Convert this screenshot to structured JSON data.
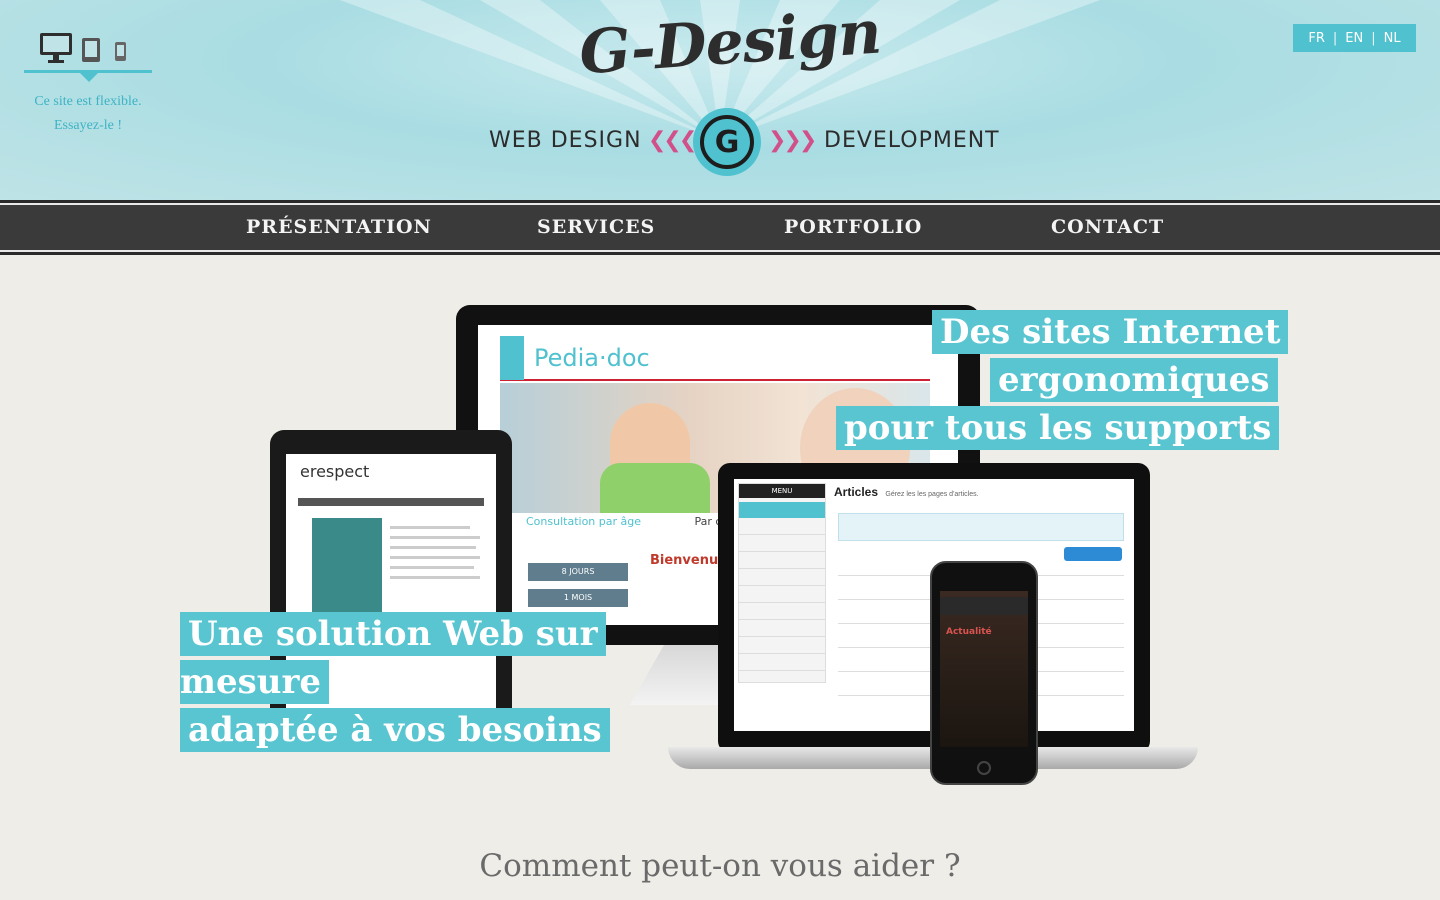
{
  "header": {
    "flex_note_line1": "Ce site est flexible.",
    "flex_note_line2": "Essayez-le !",
    "device_icons": [
      "desktop-icon",
      "tablet-icon",
      "phone-icon"
    ],
    "languages": [
      "FR",
      "EN",
      "NL"
    ],
    "logo": "G-Design",
    "tagline_left": "WEB DESIGN",
    "tagline_right": "DEVELOPMENT",
    "emblem_letter": "G",
    "accent_color": "#4fc1cf",
    "chevron_color": "#d2508a"
  },
  "nav": {
    "items": [
      "PRÉSENTATION",
      "SERVICES",
      "PORTFOLIO",
      "CONTACT"
    ]
  },
  "hero": {
    "headline_right": [
      "Des sites Internet",
      "ergonomiques",
      "pour tous les supports"
    ],
    "headline_left": [
      "Une solution Web sur",
      "mesure",
      "adaptée à vos besoins"
    ],
    "mock": {
      "desktop_site": "Pedia·doc",
      "desktop_sub": "Consultation par âge",
      "desktop_side": "Par caté",
      "desktop_buttons": [
        "8 JOURS",
        "1 MOIS"
      ],
      "desktop_welcome": "Bienvenue",
      "tablet_site": "erespect",
      "laptop_menu": "MENU",
      "laptop_title": "Articles",
      "laptop_subtitle": "Gérez les les pages d'articles.",
      "phone_title": "Actualité"
    }
  },
  "footer_prompt": "Comment peut-on vous aider ?"
}
